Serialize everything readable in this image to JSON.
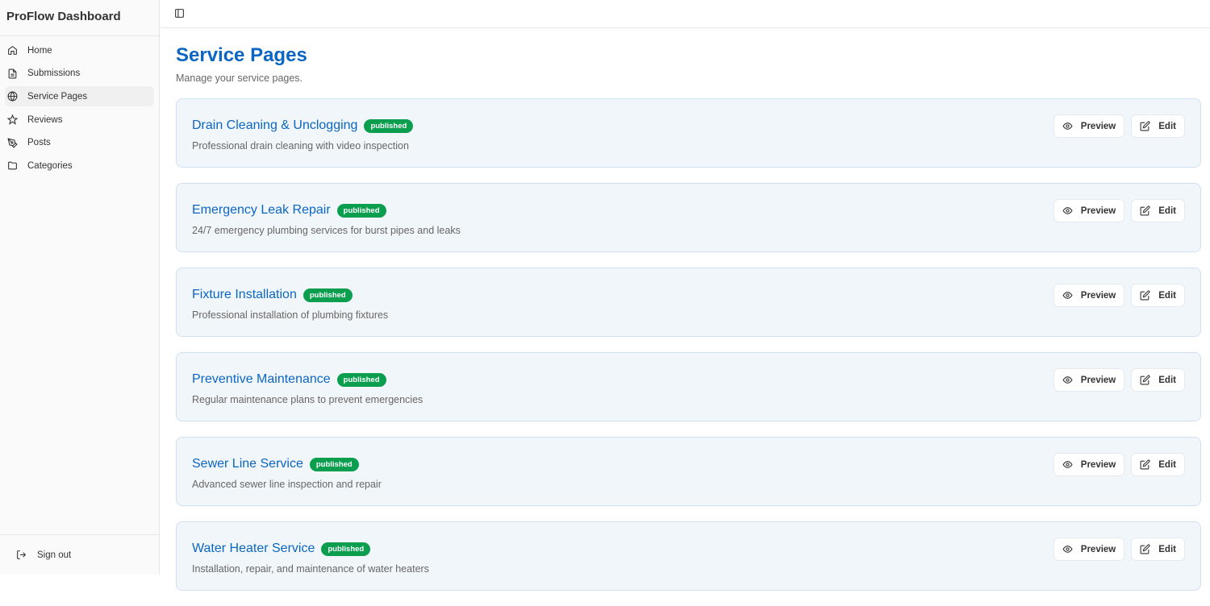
{
  "app_title": "ProFlow Dashboard",
  "nav": [
    {
      "label": "Home",
      "icon": "home-icon"
    },
    {
      "label": "Submissions",
      "icon": "file-icon"
    },
    {
      "label": "Service Pages",
      "icon": "globe-icon"
    },
    {
      "label": "Reviews",
      "icon": "star-icon"
    },
    {
      "label": "Posts",
      "icon": "pen-icon"
    },
    {
      "label": "Categories",
      "icon": "folder-icon"
    }
  ],
  "active_nav": "Service Pages",
  "signout": "Sign out",
  "page": {
    "title": "Service Pages",
    "subtitle": "Manage your service pages."
  },
  "buttons": {
    "preview": "Preview",
    "edit": "Edit"
  },
  "services": [
    {
      "title": "Drain Cleaning & Unclogging",
      "status": "published",
      "desc": "Professional drain cleaning with video inspection"
    },
    {
      "title": "Emergency Leak Repair",
      "status": "published",
      "desc": "24/7 emergency plumbing services for burst pipes and leaks"
    },
    {
      "title": "Fixture Installation",
      "status": "published",
      "desc": "Professional installation of plumbing fixtures"
    },
    {
      "title": "Preventive Maintenance",
      "status": "published",
      "desc": "Regular maintenance plans to prevent emergencies"
    },
    {
      "title": "Sewer Line Service",
      "status": "published",
      "desc": "Advanced sewer line inspection and repair"
    },
    {
      "title": "Water Heater Service",
      "status": "published",
      "desc": "Installation, repair, and maintenance of water heaters"
    }
  ]
}
